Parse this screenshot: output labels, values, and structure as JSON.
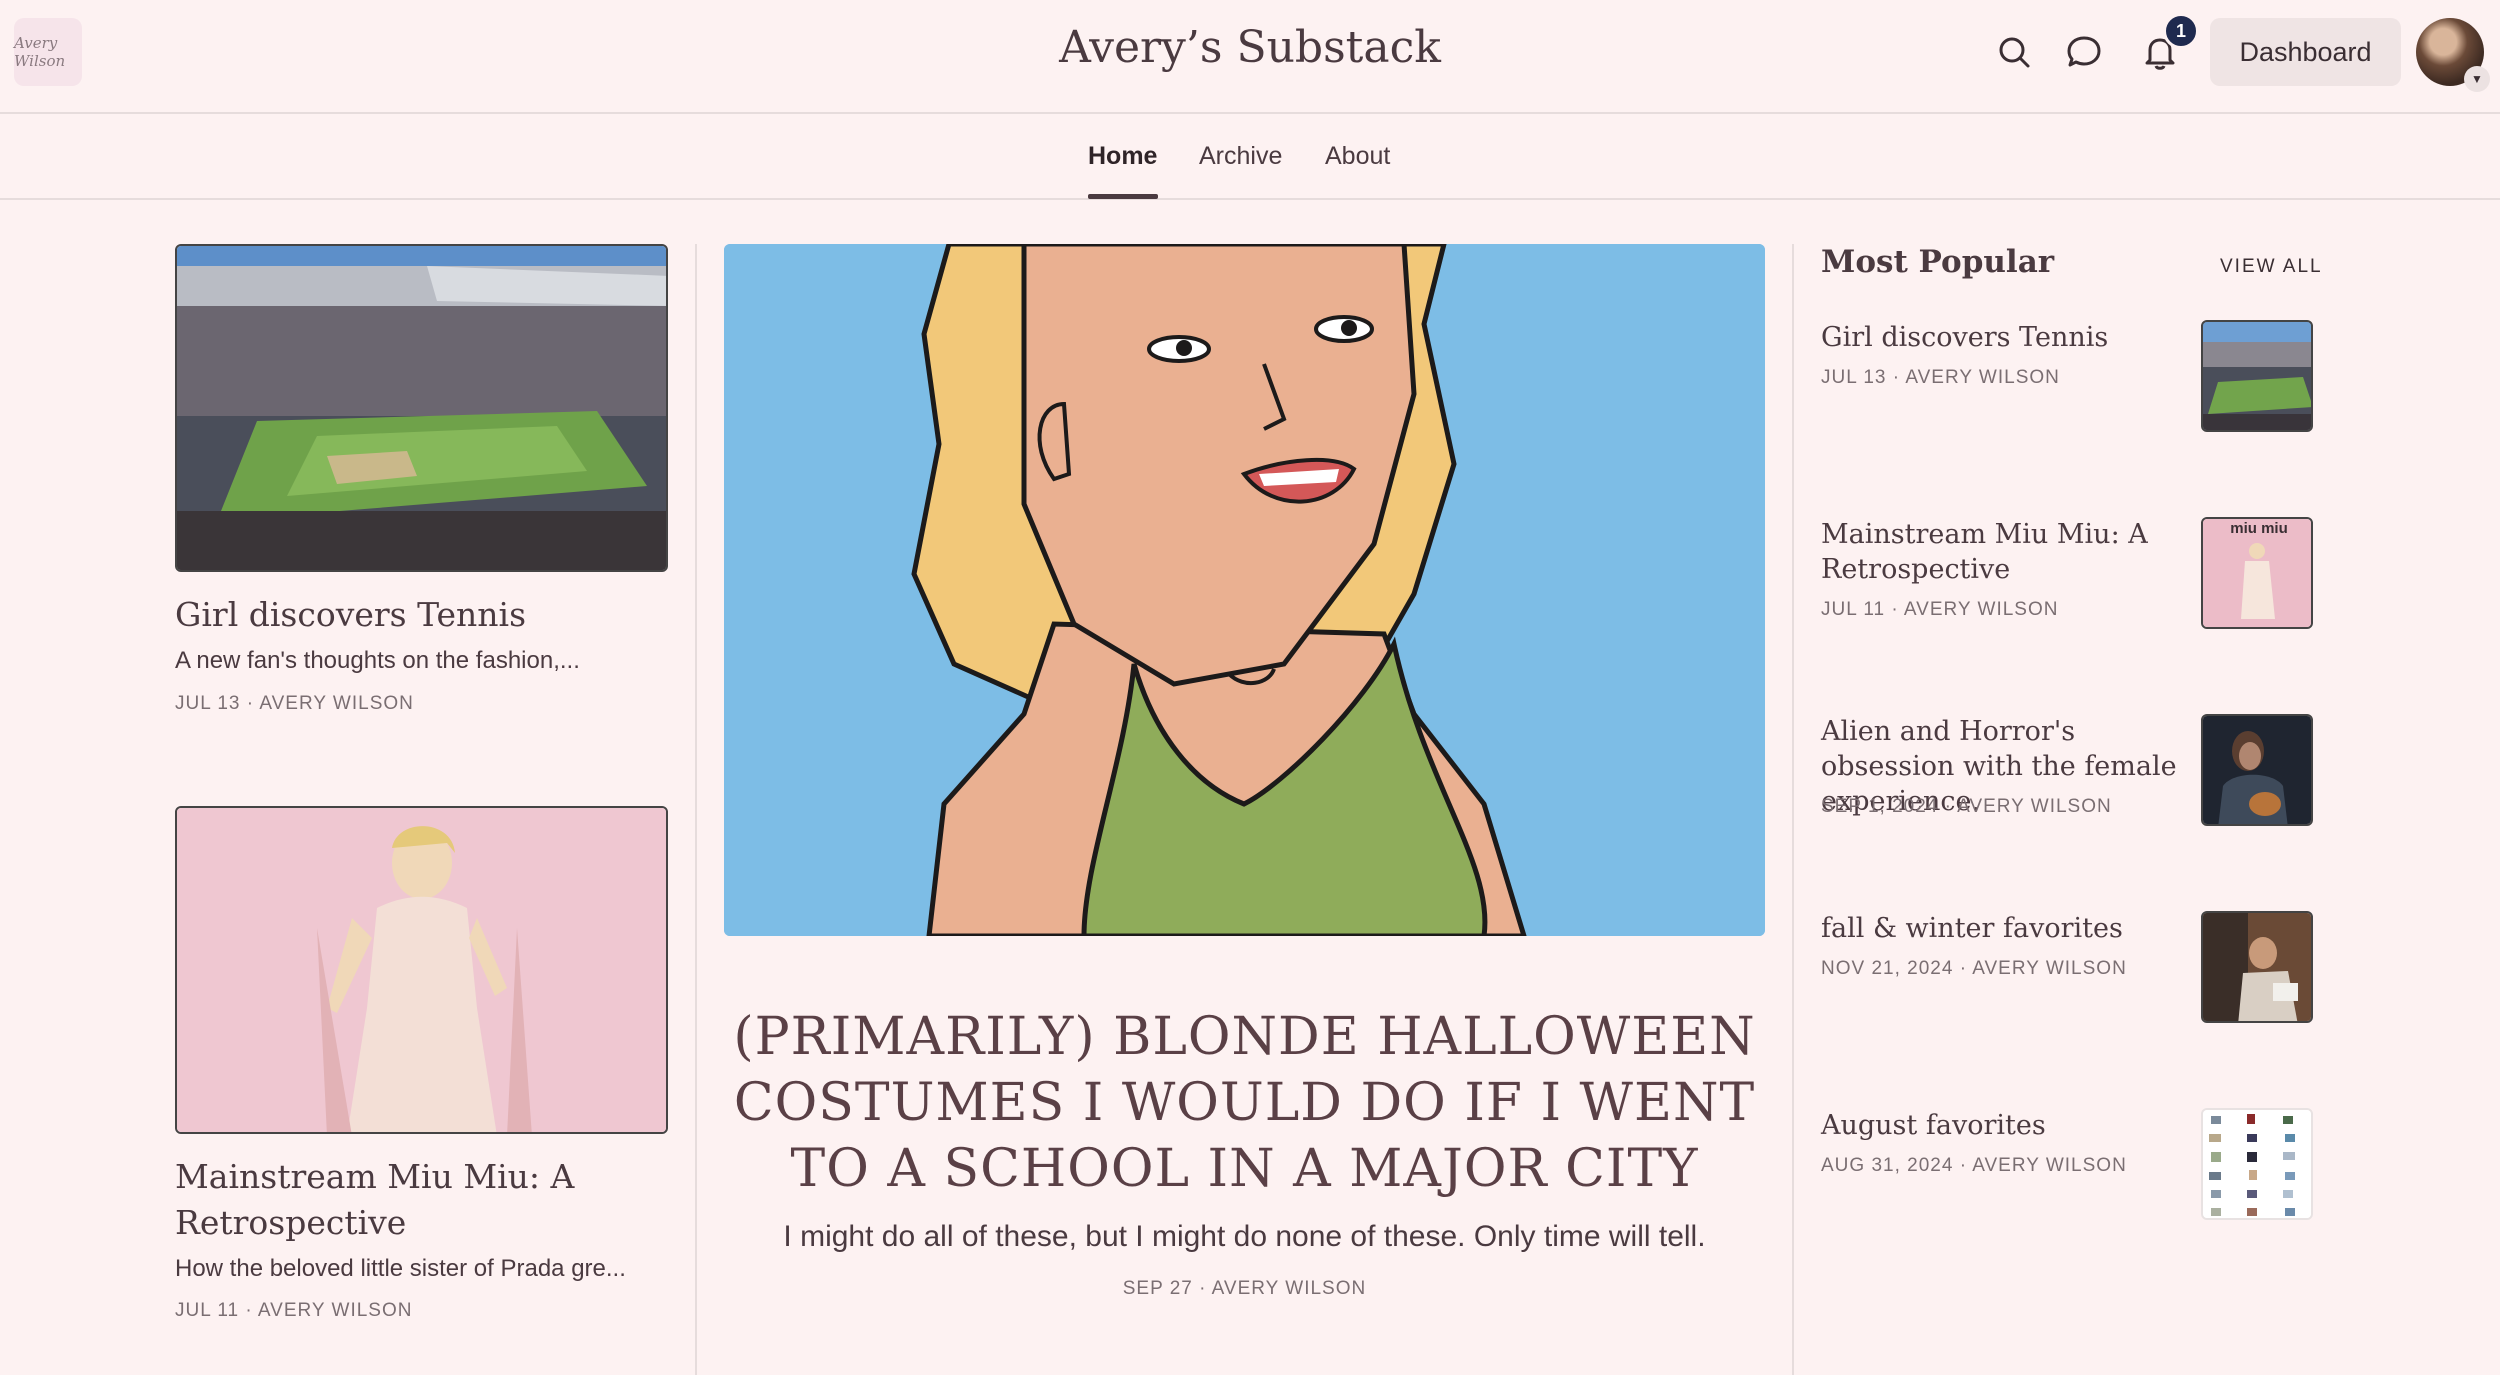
{
  "header": {
    "logo_text": "Avery Wilson",
    "site_title": "Avery’s Substack",
    "notification_count": "1",
    "dashboard_label": "Dashboard",
    "icons": [
      "search-icon",
      "chat-icon",
      "bell-icon",
      "chevron-down-icon"
    ]
  },
  "nav": {
    "items": [
      {
        "label": "Home",
        "active": true
      },
      {
        "label": "Archive",
        "active": false
      },
      {
        "label": "About",
        "active": false
      }
    ]
  },
  "left_posts": [
    {
      "title": "Girl discovers Tennis",
      "subtitle": "A new fan's thoughts on the fashion,...",
      "meta": "JUL 13 · AVERY WILSON"
    },
    {
      "title": "Mainstream Miu Miu: A Retrospective",
      "subtitle": "How the beloved little sister of Prada gre...",
      "meta": "JUL 11 · AVERY WILSON"
    }
  ],
  "featured": {
    "title": "(PRIMARILY) BLONDE HALLOWEEN COSTUMES I WOULD DO IF I WENT TO A SCHOOL IN A MAJOR CITY",
    "subtitle": "I might do all of these, but I might do none of these. Only time will tell.",
    "meta": "SEP 27 · AVERY WILSON"
  },
  "most_popular": {
    "heading": "Most Popular",
    "view_all": "VIEW ALL",
    "items": [
      {
        "title": "Girl discovers Tennis",
        "meta": "JUL 13 · AVERY WILSON"
      },
      {
        "title": "Mainstream Miu Miu: A Retrospective",
        "meta": "JUL 11 · AVERY WILSON",
        "thumb_text": "miu miu"
      },
      {
        "title": "Alien and Horror's obsession with the female experience.",
        "meta": "SEP 1, 2024 · AVERY WILSON"
      },
      {
        "title": "fall & winter favorites",
        "meta": "NOV 21, 2024 · AVERY WILSON"
      },
      {
        "title": "August favorites",
        "meta": "AUG 31, 2024 · AVERY WILSON"
      }
    ]
  },
  "colors": {
    "background": "#fdf2f2",
    "text": "#4a3a40",
    "meta": "#7a6e72",
    "badge": "#1f2a4f",
    "hero_sky": "#7dbde6"
  }
}
